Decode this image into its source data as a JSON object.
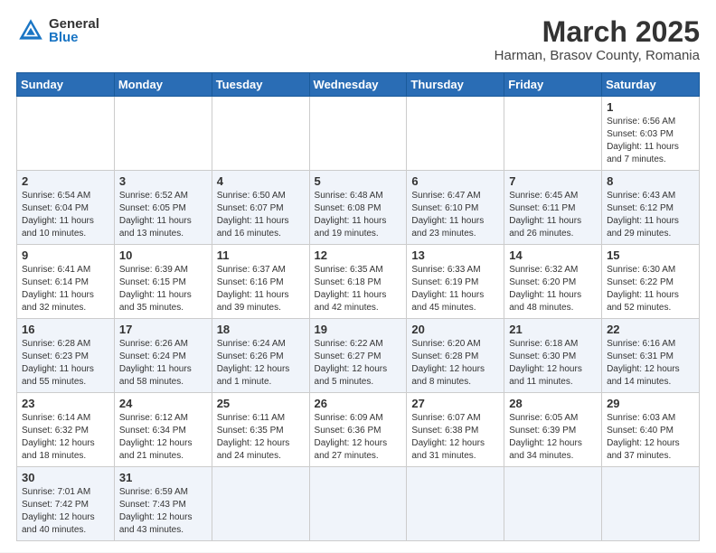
{
  "header": {
    "logo_general": "General",
    "logo_blue": "Blue",
    "month_year": "March 2025",
    "location": "Harman, Brasov County, Romania"
  },
  "days_of_week": [
    "Sunday",
    "Monday",
    "Tuesday",
    "Wednesday",
    "Thursday",
    "Friday",
    "Saturday"
  ],
  "weeks": [
    [
      {
        "day": "",
        "info": ""
      },
      {
        "day": "",
        "info": ""
      },
      {
        "day": "",
        "info": ""
      },
      {
        "day": "",
        "info": ""
      },
      {
        "day": "",
        "info": ""
      },
      {
        "day": "",
        "info": ""
      },
      {
        "day": "1",
        "info": "Sunrise: 6:56 AM\nSunset: 6:03 PM\nDaylight: 11 hours and 7 minutes."
      }
    ],
    [
      {
        "day": "2",
        "info": "Sunrise: 6:54 AM\nSunset: 6:04 PM\nDaylight: 11 hours and 10 minutes."
      },
      {
        "day": "3",
        "info": "Sunrise: 6:52 AM\nSunset: 6:05 PM\nDaylight: 11 hours and 13 minutes."
      },
      {
        "day": "4",
        "info": "Sunrise: 6:50 AM\nSunset: 6:07 PM\nDaylight: 11 hours and 16 minutes."
      },
      {
        "day": "5",
        "info": "Sunrise: 6:48 AM\nSunset: 6:08 PM\nDaylight: 11 hours and 19 minutes."
      },
      {
        "day": "6",
        "info": "Sunrise: 6:47 AM\nSunset: 6:10 PM\nDaylight: 11 hours and 23 minutes."
      },
      {
        "day": "7",
        "info": "Sunrise: 6:45 AM\nSunset: 6:11 PM\nDaylight: 11 hours and 26 minutes."
      },
      {
        "day": "8",
        "info": "Sunrise: 6:43 AM\nSunset: 6:12 PM\nDaylight: 11 hours and 29 minutes."
      }
    ],
    [
      {
        "day": "9",
        "info": "Sunrise: 6:41 AM\nSunset: 6:14 PM\nDaylight: 11 hours and 32 minutes."
      },
      {
        "day": "10",
        "info": "Sunrise: 6:39 AM\nSunset: 6:15 PM\nDaylight: 11 hours and 35 minutes."
      },
      {
        "day": "11",
        "info": "Sunrise: 6:37 AM\nSunset: 6:16 PM\nDaylight: 11 hours and 39 minutes."
      },
      {
        "day": "12",
        "info": "Sunrise: 6:35 AM\nSunset: 6:18 PM\nDaylight: 11 hours and 42 minutes."
      },
      {
        "day": "13",
        "info": "Sunrise: 6:33 AM\nSunset: 6:19 PM\nDaylight: 11 hours and 45 minutes."
      },
      {
        "day": "14",
        "info": "Sunrise: 6:32 AM\nSunset: 6:20 PM\nDaylight: 11 hours and 48 minutes."
      },
      {
        "day": "15",
        "info": "Sunrise: 6:30 AM\nSunset: 6:22 PM\nDaylight: 11 hours and 52 minutes."
      }
    ],
    [
      {
        "day": "16",
        "info": "Sunrise: 6:28 AM\nSunset: 6:23 PM\nDaylight: 11 hours and 55 minutes."
      },
      {
        "day": "17",
        "info": "Sunrise: 6:26 AM\nSunset: 6:24 PM\nDaylight: 11 hours and 58 minutes."
      },
      {
        "day": "18",
        "info": "Sunrise: 6:24 AM\nSunset: 6:26 PM\nDaylight: 12 hours and 1 minute."
      },
      {
        "day": "19",
        "info": "Sunrise: 6:22 AM\nSunset: 6:27 PM\nDaylight: 12 hours and 5 minutes."
      },
      {
        "day": "20",
        "info": "Sunrise: 6:20 AM\nSunset: 6:28 PM\nDaylight: 12 hours and 8 minutes."
      },
      {
        "day": "21",
        "info": "Sunrise: 6:18 AM\nSunset: 6:30 PM\nDaylight: 12 hours and 11 minutes."
      },
      {
        "day": "22",
        "info": "Sunrise: 6:16 AM\nSunset: 6:31 PM\nDaylight: 12 hours and 14 minutes."
      }
    ],
    [
      {
        "day": "23",
        "info": "Sunrise: 6:14 AM\nSunset: 6:32 PM\nDaylight: 12 hours and 18 minutes."
      },
      {
        "day": "24",
        "info": "Sunrise: 6:12 AM\nSunset: 6:34 PM\nDaylight: 12 hours and 21 minutes."
      },
      {
        "day": "25",
        "info": "Sunrise: 6:11 AM\nSunset: 6:35 PM\nDaylight: 12 hours and 24 minutes."
      },
      {
        "day": "26",
        "info": "Sunrise: 6:09 AM\nSunset: 6:36 PM\nDaylight: 12 hours and 27 minutes."
      },
      {
        "day": "27",
        "info": "Sunrise: 6:07 AM\nSunset: 6:38 PM\nDaylight: 12 hours and 31 minutes."
      },
      {
        "day": "28",
        "info": "Sunrise: 6:05 AM\nSunset: 6:39 PM\nDaylight: 12 hours and 34 minutes."
      },
      {
        "day": "29",
        "info": "Sunrise: 6:03 AM\nSunset: 6:40 PM\nDaylight: 12 hours and 37 minutes."
      }
    ],
    [
      {
        "day": "30",
        "info": "Sunrise: 7:01 AM\nSunset: 7:42 PM\nDaylight: 12 hours and 40 minutes."
      },
      {
        "day": "31",
        "info": "Sunrise: 6:59 AM\nSunset: 7:43 PM\nDaylight: 12 hours and 43 minutes."
      },
      {
        "day": "",
        "info": ""
      },
      {
        "day": "",
        "info": ""
      },
      {
        "day": "",
        "info": ""
      },
      {
        "day": "",
        "info": ""
      },
      {
        "day": "",
        "info": ""
      }
    ]
  ]
}
